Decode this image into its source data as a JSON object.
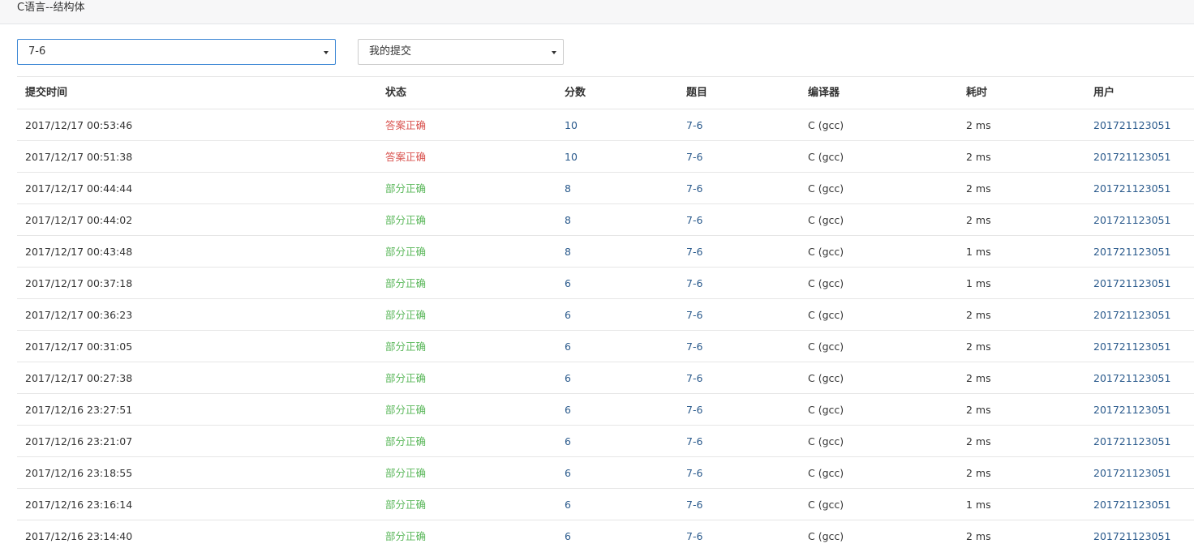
{
  "header": {
    "title": "C语言--结构体"
  },
  "filters": {
    "problem_select": {
      "value": "7-6"
    },
    "scope_select": {
      "value": "我的提交"
    }
  },
  "table": {
    "columns": {
      "time": "提交时间",
      "status": "状态",
      "score": "分数",
      "problem": "题目",
      "compiler": "编译器",
      "duration": "耗时",
      "user": "用户"
    },
    "rows": [
      {
        "time": "2017/12/17 00:53:46",
        "status": "答案正确",
        "status_kind": "accepted",
        "score": "10",
        "problem": "7-6",
        "compiler": "C (gcc)",
        "duration": "2 ms",
        "user": "201721123051"
      },
      {
        "time": "2017/12/17 00:51:38",
        "status": "答案正确",
        "status_kind": "accepted",
        "score": "10",
        "problem": "7-6",
        "compiler": "C (gcc)",
        "duration": "2 ms",
        "user": "201721123051"
      },
      {
        "time": "2017/12/17 00:44:44",
        "status": "部分正确",
        "status_kind": "partial",
        "score": "8",
        "problem": "7-6",
        "compiler": "C (gcc)",
        "duration": "2 ms",
        "user": "201721123051"
      },
      {
        "time": "2017/12/17 00:44:02",
        "status": "部分正确",
        "status_kind": "partial",
        "score": "8",
        "problem": "7-6",
        "compiler": "C (gcc)",
        "duration": "2 ms",
        "user": "201721123051"
      },
      {
        "time": "2017/12/17 00:43:48",
        "status": "部分正确",
        "status_kind": "partial",
        "score": "8",
        "problem": "7-6",
        "compiler": "C (gcc)",
        "duration": "1 ms",
        "user": "201721123051"
      },
      {
        "time": "2017/12/17 00:37:18",
        "status": "部分正确",
        "status_kind": "partial",
        "score": "6",
        "problem": "7-6",
        "compiler": "C (gcc)",
        "duration": "1 ms",
        "user": "201721123051"
      },
      {
        "time": "2017/12/17 00:36:23",
        "status": "部分正确",
        "status_kind": "partial",
        "score": "6",
        "problem": "7-6",
        "compiler": "C (gcc)",
        "duration": "2 ms",
        "user": "201721123051"
      },
      {
        "time": "2017/12/17 00:31:05",
        "status": "部分正确",
        "status_kind": "partial",
        "score": "6",
        "problem": "7-6",
        "compiler": "C (gcc)",
        "duration": "2 ms",
        "user": "201721123051"
      },
      {
        "time": "2017/12/17 00:27:38",
        "status": "部分正确",
        "status_kind": "partial",
        "score": "6",
        "problem": "7-6",
        "compiler": "C (gcc)",
        "duration": "2 ms",
        "user": "201721123051"
      },
      {
        "time": "2017/12/16 23:27:51",
        "status": "部分正确",
        "status_kind": "partial",
        "score": "6",
        "problem": "7-6",
        "compiler": "C (gcc)",
        "duration": "2 ms",
        "user": "201721123051"
      },
      {
        "time": "2017/12/16 23:21:07",
        "status": "部分正确",
        "status_kind": "partial",
        "score": "6",
        "problem": "7-6",
        "compiler": "C (gcc)",
        "duration": "2 ms",
        "user": "201721123051"
      },
      {
        "time": "2017/12/16 23:18:55",
        "status": "部分正确",
        "status_kind": "partial",
        "score": "6",
        "problem": "7-6",
        "compiler": "C (gcc)",
        "duration": "2 ms",
        "user": "201721123051"
      },
      {
        "time": "2017/12/16 23:16:14",
        "status": "部分正确",
        "status_kind": "partial",
        "score": "6",
        "problem": "7-6",
        "compiler": "C (gcc)",
        "duration": "1 ms",
        "user": "201721123051"
      },
      {
        "time": "2017/12/16 23:14:40",
        "status": "部分正确",
        "status_kind": "partial",
        "score": "6",
        "problem": "7-6",
        "compiler": "C (gcc)",
        "duration": "2 ms",
        "user": "201721123051"
      }
    ]
  },
  "colors": {
    "accepted": "#d9534f",
    "partial": "#5cb85c",
    "link": "#2a5a8c",
    "select_focus_border": "#3a86d4"
  }
}
